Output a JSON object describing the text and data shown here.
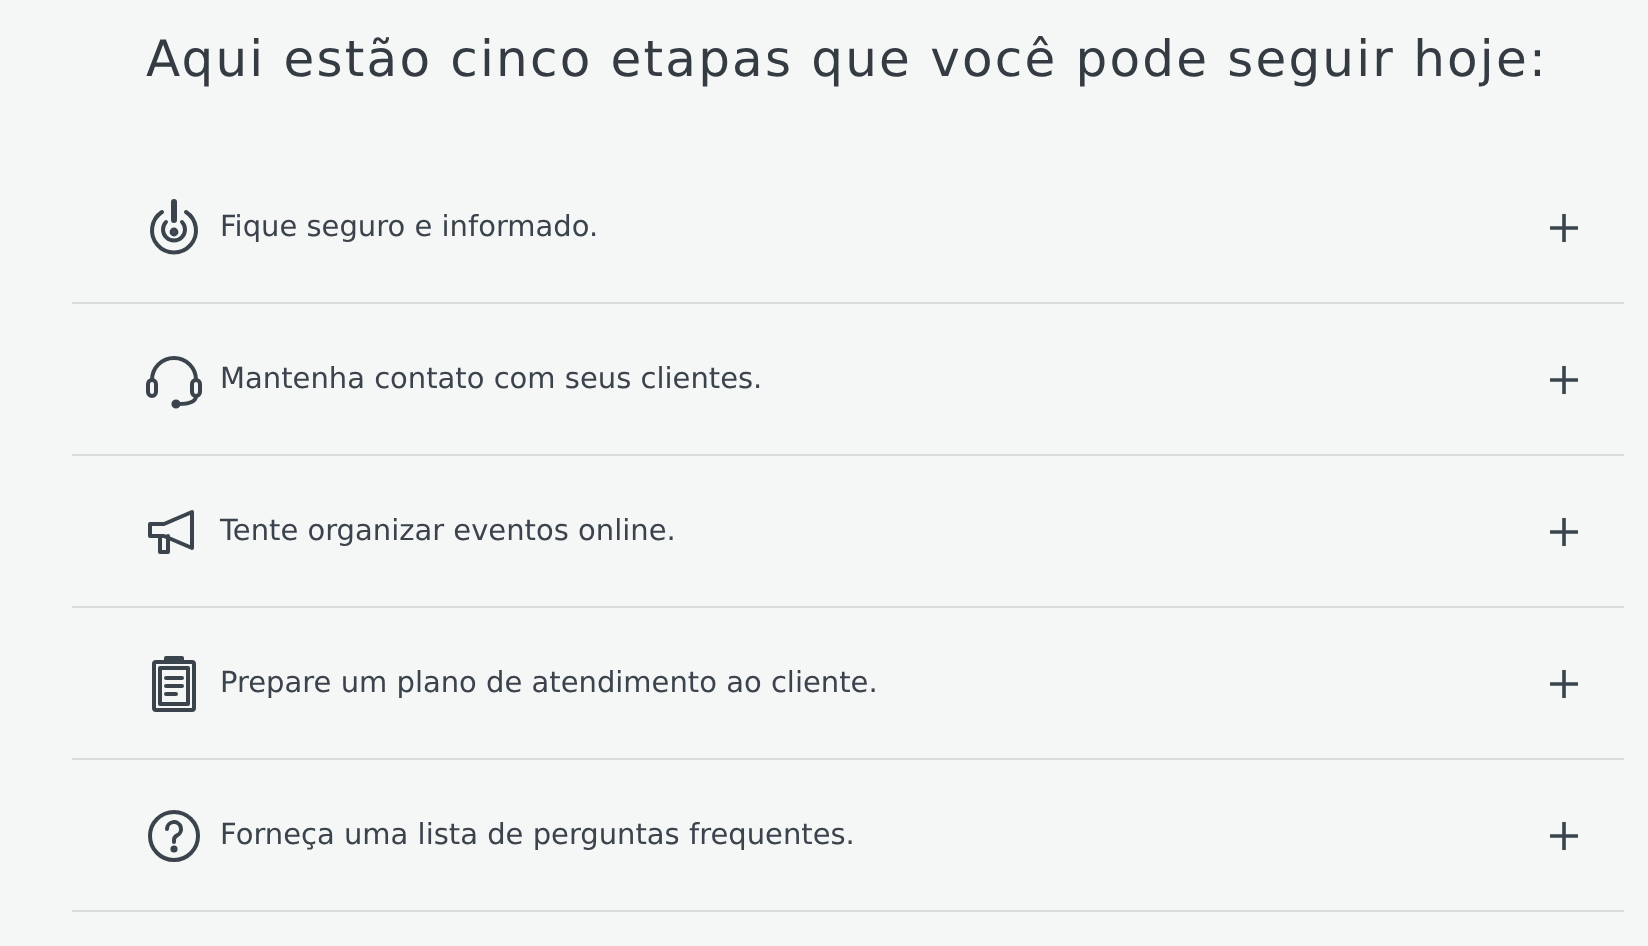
{
  "heading": "Aqui estão cinco etapas que você pode seguir hoje:",
  "steps": [
    {
      "kind": "alert",
      "label": "Fique seguro e informado.",
      "expanded": false
    },
    {
      "kind": "headset",
      "label": "Mantenha contato com seus clientes.",
      "expanded": false
    },
    {
      "kind": "megaphone",
      "label": "Tente organizar eventos online.",
      "expanded": false
    },
    {
      "kind": "clipboard",
      "label": "Prepare um plano de atendimento ao cliente.",
      "expanded": false
    },
    {
      "kind": "question",
      "label": "Forneça uma lista de perguntas frequentes.",
      "expanded": false
    }
  ]
}
